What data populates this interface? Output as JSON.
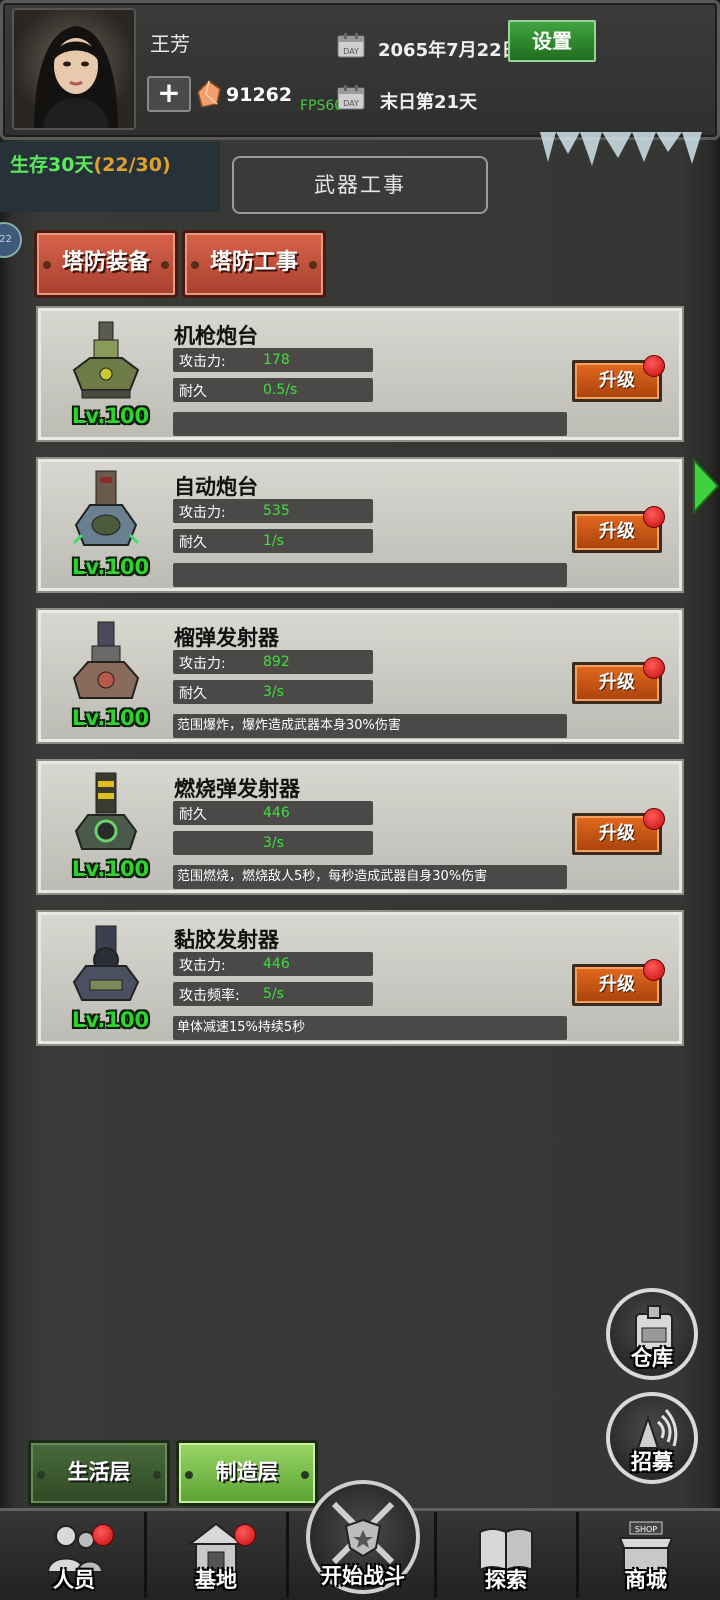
{
  "header": {
    "player_name": "王芳",
    "gem_count": "91262",
    "fps": "FPS60",
    "date": "2065年7月22日",
    "doom_day": "末日第21天",
    "settings_label": "设置",
    "plus_label": "+",
    "calendar_icon_text": "DAY"
  },
  "survival": {
    "label": "生存30天",
    "progress": "(22/30)"
  },
  "side_badge": "22",
  "section_title": "武器工事",
  "tabs": [
    {
      "label": "塔防装备"
    },
    {
      "label": "塔防工事"
    }
  ],
  "upgrade_label": "升级",
  "cards": [
    {
      "name": "机枪炮台",
      "level": "Lv.100",
      "stats": [
        {
          "label": "攻击力:",
          "value": "178"
        },
        {
          "label": "耐久",
          "value": "0.5/s"
        }
      ],
      "description": ""
    },
    {
      "name": "自动炮台",
      "level": "Lv.100",
      "stats": [
        {
          "label": "攻击力:",
          "value": "535"
        },
        {
          "label": "耐久",
          "value": "1/s"
        }
      ],
      "description": ""
    },
    {
      "name": "榴弹发射器",
      "level": "Lv.100",
      "stats": [
        {
          "label": "攻击力:",
          "value": "892"
        },
        {
          "label": "耐久",
          "value": "3/s"
        }
      ],
      "description": "范围爆炸，爆炸造成武器本身30%伤害"
    },
    {
      "name": "燃烧弹发射器",
      "level": "Lv.100",
      "stats": [
        {
          "label": "耐久",
          "value": "446"
        },
        {
          "label": "",
          "value": "3/s"
        }
      ],
      "description": "范围燃烧，燃烧敌人5秒，每秒造成武器自身30%伤害"
    },
    {
      "name": "黏胶发射器",
      "level": "Lv.100",
      "stats": [
        {
          "label": "攻击力:",
          "value": "446"
        },
        {
          "label": "攻击频率:",
          "value": "5/s"
        }
      ],
      "description": "单体减速15%持续5秒"
    }
  ],
  "side_buttons": {
    "warehouse": "仓库",
    "recruit": "招募"
  },
  "layers": {
    "living": "生活层",
    "crafting": "制造层"
  },
  "nav": {
    "personnel": "人员",
    "base": "基地",
    "battle": "开始战斗",
    "explore": "探索",
    "shop": "商城",
    "shop_sign": "SHOP"
  },
  "colors": {
    "accent_green": "#3de03d",
    "tab_red": "#c9533c",
    "upgrade_orange": "#d4601a",
    "badge_red": "#e01414"
  }
}
